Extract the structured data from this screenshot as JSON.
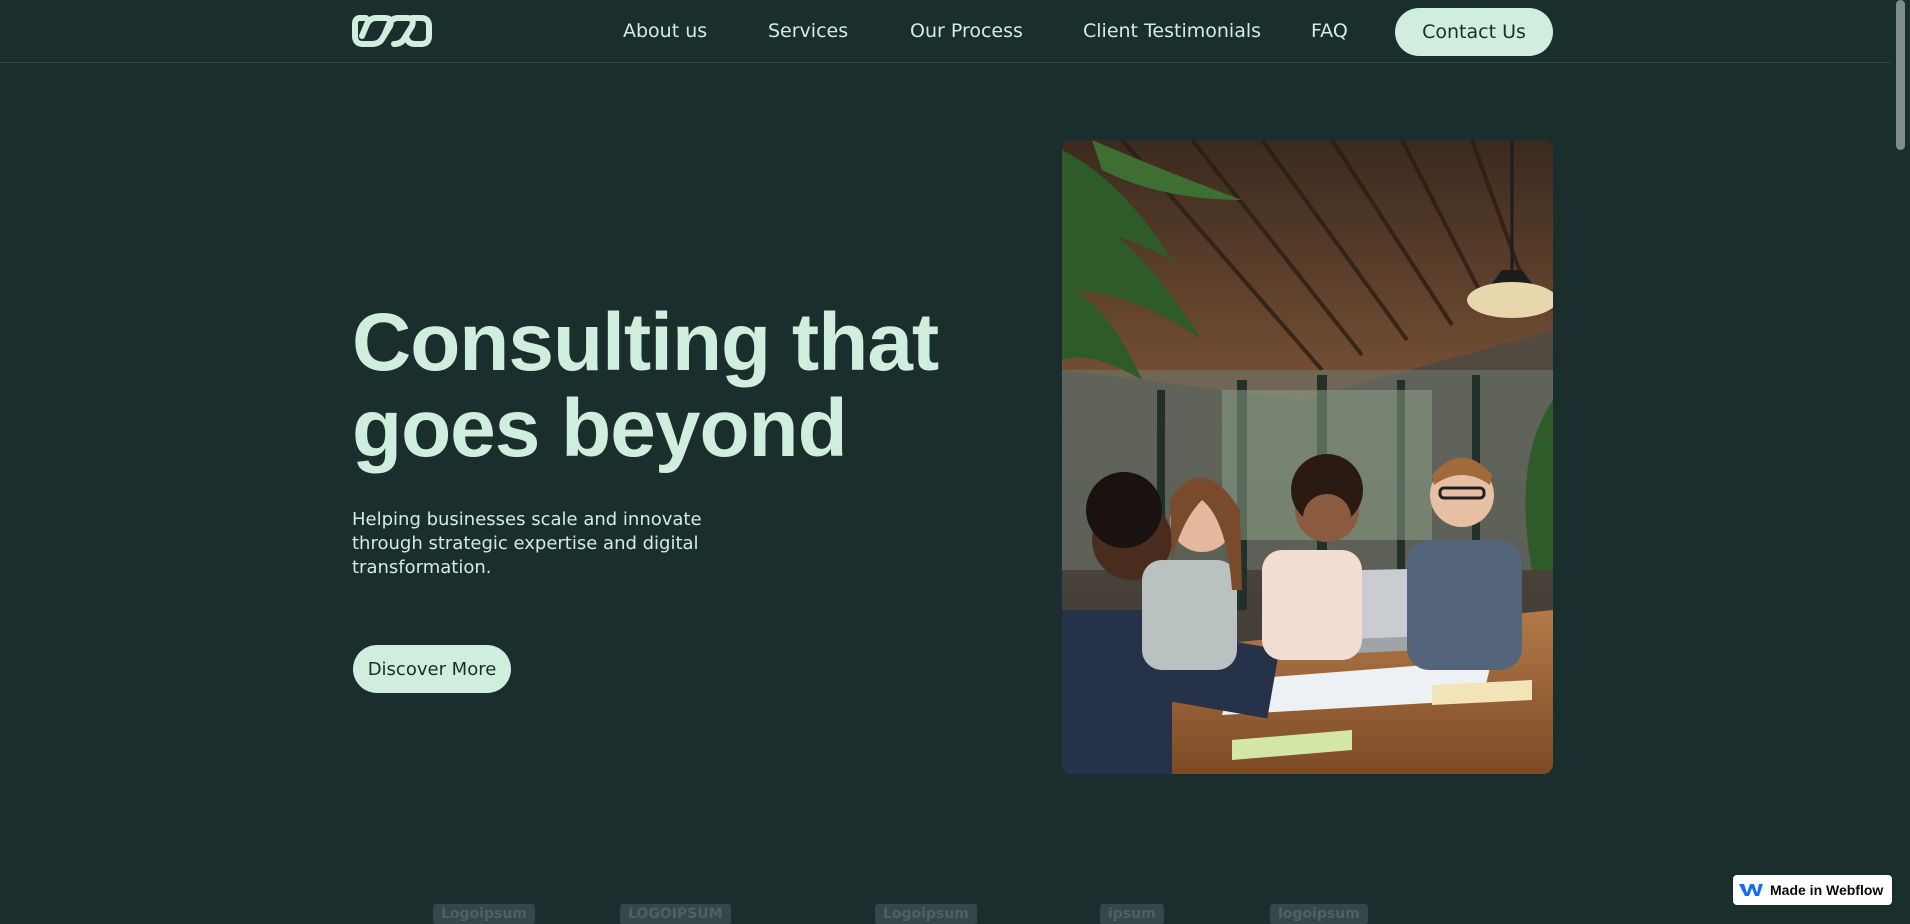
{
  "nav": {
    "logo_icon": "infinity-links-icon",
    "links": [
      {
        "label": "About us"
      },
      {
        "label": "Services"
      },
      {
        "label": "Our Process"
      },
      {
        "label": "Client Testimonials"
      },
      {
        "label": "FAQ"
      }
    ],
    "contact_label": "Contact Us"
  },
  "hero": {
    "title": "Consulting that goes beyond",
    "subtitle": "Helping businesses scale and innovate through strategic expertise and digital transformation.",
    "cta_label": "Discover More",
    "image_description": "team-meeting-photo"
  },
  "logos": {
    "items": [
      {
        "name": "Logoipsum"
      },
      {
        "name": "LOGOIPSUM"
      },
      {
        "name": "Logoipsum"
      },
      {
        "name": "ipsum"
      },
      {
        "name": "logoipsum"
      }
    ]
  },
  "badge": {
    "label": "Made in Webflow",
    "icon": "webflow-icon"
  },
  "colors": {
    "background": "#1a2e2e",
    "accent": "#cfeedd",
    "divider": "#2f4a44"
  }
}
